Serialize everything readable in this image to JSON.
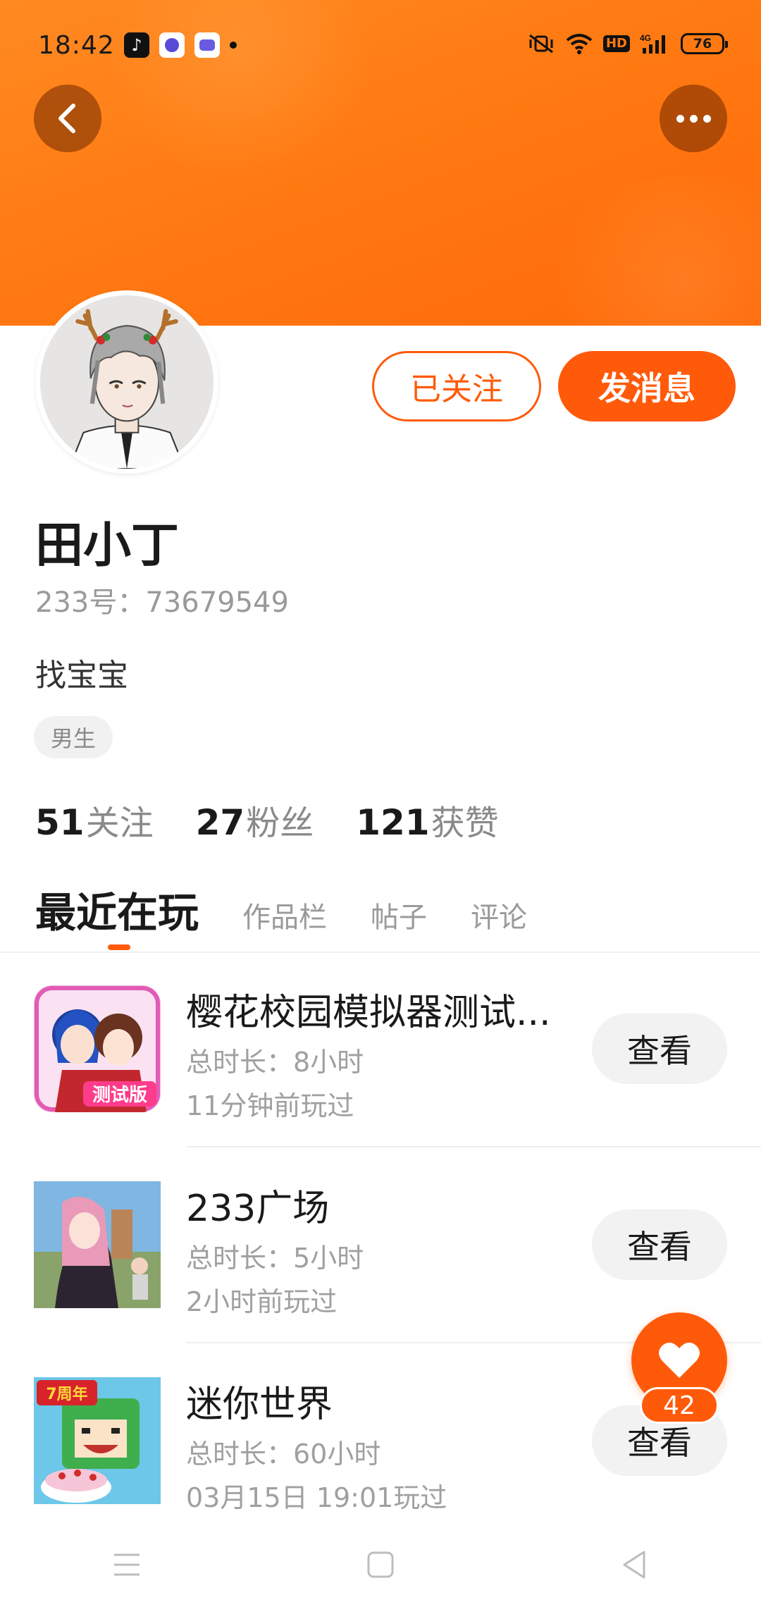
{
  "status_bar": {
    "time": "18:42",
    "battery": "76",
    "network": "4G",
    "hd": "HD"
  },
  "profile": {
    "name": "田小丁",
    "id_line": "233号：73679549",
    "bio": "找宝宝",
    "gender_tag": "男生",
    "follow_button": "已关注",
    "message_button": "发消息"
  },
  "stats": [
    {
      "count": "51",
      "label": "关注"
    },
    {
      "count": "27",
      "label": "粉丝"
    },
    {
      "count": "121",
      "label": "获赞"
    }
  ],
  "tabs": [
    {
      "label": "最近在玩",
      "active": true
    },
    {
      "label": "作品栏",
      "active": false
    },
    {
      "label": "帖子",
      "active": false
    },
    {
      "label": "评论",
      "active": false
    }
  ],
  "games": [
    {
      "title": "樱花校园模拟器测试...",
      "duration": "总时长：8小时",
      "last_played": "11分钟前玩过",
      "button": "查看",
      "icon": "sakura-school-icon",
      "icon_badge": "测试版"
    },
    {
      "title": "233广场",
      "duration": "总时长：5小时",
      "last_played": "2小时前玩过",
      "button": "查看",
      "icon": "plaza-233-icon"
    },
    {
      "title": "迷你世界",
      "duration": "总时长：60小时",
      "last_played": "03月15日 19:01玩过",
      "button": "查看",
      "icon": "mini-world-icon",
      "icon_badge": "7周年"
    }
  ],
  "like_fab": {
    "count": "42"
  },
  "colors": {
    "accent": "#ff5a0a",
    "banner": "#ff7a12",
    "muted_text": "#9a9a9a"
  }
}
